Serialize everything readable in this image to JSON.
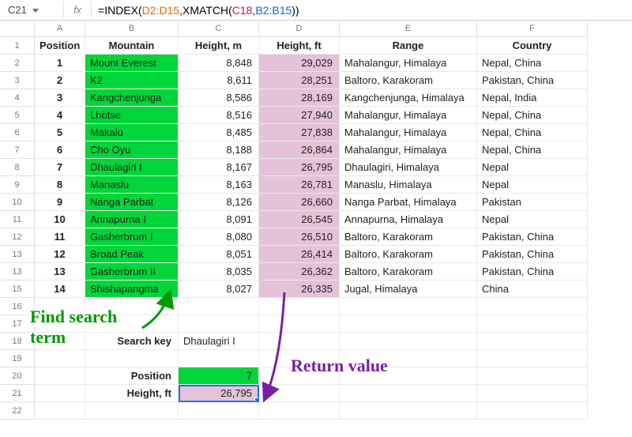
{
  "formula_bar": {
    "cell_ref": "C21",
    "fx_label": "fx",
    "eq": "=",
    "fn1": "INDEX",
    "open1": "(",
    "arg_range1": "D2:D15",
    "comma1": ",",
    "fn2": "XMATCH",
    "open2": "(",
    "arg_cell": "C18",
    "comma2": ",",
    "arg_range2": "B2:B15",
    "close2": ")",
    "close1": ")"
  },
  "columns": [
    "A",
    "B",
    "C",
    "D",
    "E",
    "F"
  ],
  "headers": {
    "position": "Position",
    "mountain": "Mountain",
    "height_m": "Height, m",
    "height_ft": "Height, ft",
    "range": "Range",
    "country": "Country"
  },
  "rows": [
    {
      "pos": "1",
      "mountain": "Mount Everest",
      "hm": "8,848",
      "hft": "29,029",
      "range": "Mahalangur, Himalaya",
      "country": "Nepal, China"
    },
    {
      "pos": "2",
      "mountain": "K2",
      "hm": "8,611",
      "hft": "28,251",
      "range": "Baltoro, Karakoram",
      "country": "Pakistan, China"
    },
    {
      "pos": "3",
      "mountain": "Kangchenjunga",
      "hm": "8,586",
      "hft": "28,169",
      "range": "Kangchenjunga, Himalaya",
      "country": "Nepal, India"
    },
    {
      "pos": "4",
      "mountain": "Lhotse",
      "hm": "8,516",
      "hft": "27,940",
      "range": "Mahalangur, Himalaya",
      "country": "Nepal, China"
    },
    {
      "pos": "5",
      "mountain": "Makalu",
      "hm": "8,485",
      "hft": "27,838",
      "range": "Mahalangur, Himalaya",
      "country": "Nepal, China"
    },
    {
      "pos": "6",
      "mountain": "Cho Oyu",
      "hm": "8,188",
      "hft": "26,864",
      "range": "Mahalangur, Himalaya",
      "country": "Nepal, China"
    },
    {
      "pos": "7",
      "mountain": "Dhaulagiri I",
      "hm": "8,167",
      "hft": "26,795",
      "range": "Dhaulagiri, Himalaya",
      "country": "Nepal"
    },
    {
      "pos": "8",
      "mountain": "Manaslu",
      "hm": "8,163",
      "hft": "26,781",
      "range": "Manaslu, Himalaya",
      "country": "Nepal"
    },
    {
      "pos": "9",
      "mountain": "Nanga Parbat",
      "hm": "8,126",
      "hft": "26,660",
      "range": "Nanga Parbat, Himalaya",
      "country": "Pakistan"
    },
    {
      "pos": "10",
      "mountain": "Annapurna I",
      "hm": "8,091",
      "hft": "26,545",
      "range": "Annapurna, Himalaya",
      "country": "Nepal"
    },
    {
      "pos": "11",
      "mountain": "Gasherbrum I",
      "hm": "8,080",
      "hft": "26,510",
      "range": "Baltoro, Karakoram",
      "country": "Pakistan, China"
    },
    {
      "pos": "12",
      "mountain": "Broad Peak",
      "hm": "8,051",
      "hft": "26,414",
      "range": "Baltoro, Karakoram",
      "country": "Pakistan, China"
    },
    {
      "pos": "13",
      "mountain": "Gasherbrum II",
      "hm": "8,035",
      "hft": "26,362",
      "range": "Baltoro, Karakoram",
      "country": "Pakistan, China"
    },
    {
      "pos": "14",
      "mountain": "Shishapangma",
      "hm": "8,027",
      "hft": "26,335",
      "range": "Jugal, Himalaya",
      "country": "China"
    }
  ],
  "row_numbers": [
    "1",
    "2",
    "3",
    "4",
    "5",
    "6",
    "7",
    "8",
    "9",
    "10",
    "11",
    "12",
    "13",
    "13",
    "15",
    "16",
    "17",
    "18",
    "19",
    "20",
    "21",
    "22"
  ],
  "lookup": {
    "search_key_label": "Search key",
    "search_key_value": "Dhaulagiri I",
    "position_label": "Position",
    "position_value": "7",
    "height_label": "Height, ft",
    "height_value": "26,795"
  },
  "annotations": {
    "find_search": "Find search\nterm",
    "return_value": "Return value"
  }
}
